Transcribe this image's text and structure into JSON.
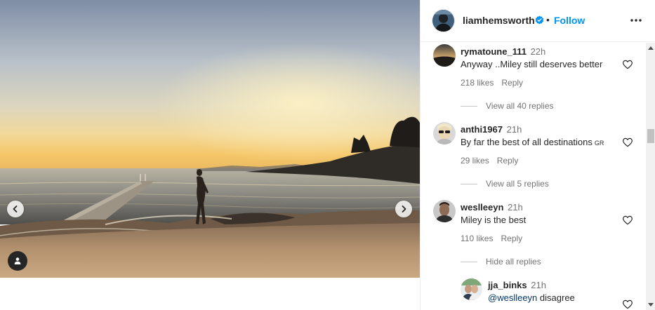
{
  "post": {
    "author": "liamhemsworth",
    "follow_label": "Follow",
    "separator": "•"
  },
  "icons": {
    "prev": "chevron-left-icon",
    "next": "chevron-right-icon",
    "tags": "user-tag-icon",
    "verified": "verified-badge-icon",
    "more": "more-options-icon",
    "like": "heart-icon"
  },
  "colors": {
    "follow_blue": "#0095f6",
    "verified_blue": "#0095f6",
    "mention": "#00376b",
    "muted": "#737373"
  },
  "comments": [
    {
      "user": "rymatoune_111",
      "time": "22h",
      "text": "Anyway ..Miley still deserves better",
      "likes": "218 likes",
      "reply": "Reply",
      "replies_toggle": "View all 40 replies"
    },
    {
      "user": "anthi1967",
      "time": "21h",
      "text": "By far the best of all destinations",
      "flag": "GR",
      "likes": "29 likes",
      "reply": "Reply",
      "replies_toggle": "View all 5 replies"
    },
    {
      "user": "weslleeyn",
      "time": "21h",
      "text": "Miley is the best",
      "likes": "110 likes",
      "reply": "Reply",
      "replies_toggle": "Hide all replies"
    }
  ],
  "reply": {
    "user": "jja_binks",
    "time": "21h",
    "mention": "@weslleeyn",
    "text": "disagree"
  }
}
